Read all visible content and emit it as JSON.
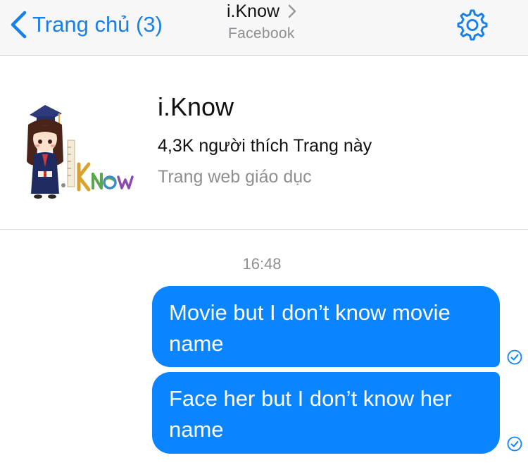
{
  "nav": {
    "back_label": "Trang chủ (3)",
    "title": "i.Know",
    "subtitle": "Facebook"
  },
  "page": {
    "name": "i.Know",
    "likes": "4,3K người thích Trang này",
    "category": "Trang web giáo dục",
    "logo_text": "i.Know"
  },
  "chat": {
    "timestamp": "16:48",
    "messages": [
      {
        "text": "Movie but I don’t know movie name",
        "status": "sent-check-icon"
      },
      {
        "text": "Face her but I don’t know her name",
        "status": "sent-check-icon"
      }
    ]
  },
  "colors": {
    "accent": "#1a80e6",
    "bubble": "#0a84ff",
    "secondary_text": "#8e8e93"
  }
}
